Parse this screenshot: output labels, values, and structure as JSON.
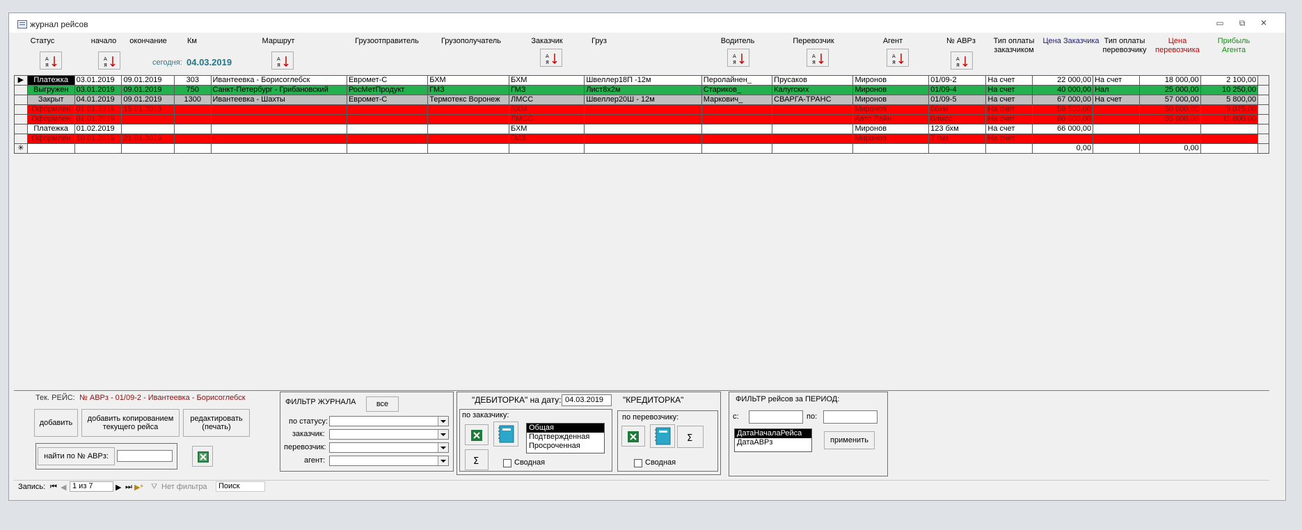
{
  "window": {
    "title": "журнал рейсов"
  },
  "columns": [
    "Статус",
    "начало",
    "окончание",
    "Км",
    "Маршрут",
    "Грузоотправитель",
    "Грузополучатель",
    "Заказчик",
    "Груз",
    "Водитель",
    "Перевозчик",
    "Агент",
    "№ АВРз",
    "Тип оплаты заказчиком",
    "Цена Заказчика",
    "Тип оплаты перевозчику",
    "Цена перевозчика",
    "Прибыль Агента"
  ],
  "header": {
    "status": "Статус",
    "start": "начало",
    "end": "окончание",
    "km": "Км",
    "route": "Маршрут",
    "shipper": "Грузоотправитель",
    "consignee": "Грузополучатель",
    "customer": "Заказчик",
    "cargo": "Груз",
    "driver": "Водитель",
    "carrier": "Перевозчик",
    "agent": "Агент",
    "avr": "№ АВРз",
    "pay_customer_1": "Тип оплаты",
    "pay_customer_2": "заказчиком",
    "price_customer": "Цена Заказчика",
    "pay_carrier_1": "Тип оплаты",
    "pay_carrier_2": "перевозчику",
    "price_carrier_1": "Цена",
    "price_carrier_2": "перевозчика",
    "profit_1": "Прибыль",
    "profit_2": "Агента",
    "today_label": "сегодня:",
    "today_value": "04.03.2019"
  },
  "colors": {
    "green": "#22b14c",
    "red": "#ff0000",
    "gray": "#c0c0c0",
    "price_customer": "#1a1a7a",
    "price_carrier": "#c00000",
    "profit": "#1a8a1a"
  },
  "rows": [
    {
      "style": "white",
      "current": true,
      "cells": [
        "Платежка",
        "03.01.2019",
        "09.01.2019",
        "303",
        "Ивантеевка - Борисоглебск",
        "Евромет-С",
        "БХМ",
        "БХМ",
        "Швеллер18П -12м",
        "Перолайнен_",
        "Прусаков",
        "Миронов",
        "01/09-2",
        "На счет",
        "22 000,00",
        "На счет",
        "18 000,00",
        "2 100,00"
      ]
    },
    {
      "style": "green",
      "cells": [
        "Выгружен",
        "03.01.2019",
        "09.01.2019",
        "750",
        "Санкт-Петербург - Грибановский",
        "РосМетПродукт",
        "ГМЗ",
        "ГМЗ",
        "Лист8х2м",
        "Стариков_",
        "Калугских",
        "Миронов",
        "01/09-4",
        "На счет",
        "40 000,00",
        "Нал",
        "25 000,00",
        "10 250,00"
      ]
    },
    {
      "style": "gray",
      "cells": [
        "Закрыт",
        "04.01.2019",
        "09.01.2019",
        "1300",
        "Ивантеевка - Шахты",
        "Евромет-С",
        "Термотекс Воронеж",
        "ЛМСС",
        "Швеллер20Ш - 12м",
        "Маркович_",
        "СВАРГА-ТРАНС",
        "Миронов",
        "01/09-5",
        "На счет",
        "67 000,00",
        "На счет",
        "57 000,00",
        "5 800,00"
      ]
    },
    {
      "style": "red",
      "cells": [
        "Оформлен",
        "01.01.2019",
        "15.01.2019",
        "",
        "",
        "",
        "",
        "БХМ",
        "",
        "",
        "",
        "Миронов",
        "06хм",
        "На счет",
        "59 500,00",
        "",
        "50 000,00",
        "9 075,00"
      ]
    },
    {
      "style": "red",
      "cells": [
        "Оформлен",
        "01.01.2019",
        "",
        "",
        "",
        "",
        "",
        "ЛМСС",
        "",
        "",
        "",
        "Авто Лайн",
        "0лмсс",
        "На счет",
        "80 000,00",
        "",
        "55 000,00",
        "11 800,00"
      ]
    },
    {
      "style": "white",
      "cells": [
        "Платежка",
        "01.02.2019",
        "",
        "",
        "",
        "",
        "",
        "БХМ",
        "",
        "",
        "",
        "Миронов",
        "123 бхм",
        "На счет",
        "66 000,00",
        "",
        "",
        ""
      ]
    },
    {
      "style": "red",
      "cells": [
        "Оформлен",
        "10.01.2019",
        "21.01.2019",
        "",
        "-",
        "",
        "",
        "ГМЗ",
        "",
        "",
        "",
        "Миронов",
        "7 гмз",
        "На счет",
        "",
        "",
        "",
        ""
      ]
    },
    {
      "style": "new",
      "cells": [
        "",
        "",
        "",
        "",
        "",
        "",
        "",
        "",
        "",
        "",
        "",
        "",
        "",
        "",
        "0,00",
        "",
        "0,00",
        ""
      ]
    }
  ],
  "current": {
    "label": "Тек. РЕЙС:",
    "value": "№ АВРз - 01/09-2 - Ивантеевка - Борисоглебск"
  },
  "actions": {
    "add": "добавить",
    "add_copy": "добавить копированием текущего рейса",
    "edit": "редактировать (печать)",
    "find": "найти по № АВРз:",
    "find_value": ""
  },
  "filter": {
    "title": "ФИЛЬТР ЖУРНАЛА",
    "all": "все",
    "by_status": "по статусу:",
    "customer": "заказчик:",
    "carrier": "перевозчик:",
    "agent": "агент:"
  },
  "debitor": {
    "title": "\"ДЕБИТОРКА\" на дату:",
    "date": "04.03.2019",
    "by_customer": "по заказчику:",
    "options": [
      "Общая",
      "Подтвержденная",
      "Просроченная"
    ],
    "selected": "Общая",
    "summary": "Сводная"
  },
  "creditor": {
    "title": "\"КРЕДИТОРКА\"",
    "by_carrier": "по перевозчику:",
    "summary": "Сводная"
  },
  "period": {
    "title": "ФИЛЬТР рейсов за ПЕРИОД:",
    "from": "с:",
    "to": "по:",
    "options": [
      "ДатаНачалаРейса",
      "ДатаАВРз"
    ],
    "selected": "ДатаНачалаРейса",
    "apply": "применить"
  },
  "statusbar": {
    "record_label": "Запись:",
    "record_value": "1 из 7",
    "no_filter": "Нет фильтра",
    "search": "Поиск"
  }
}
